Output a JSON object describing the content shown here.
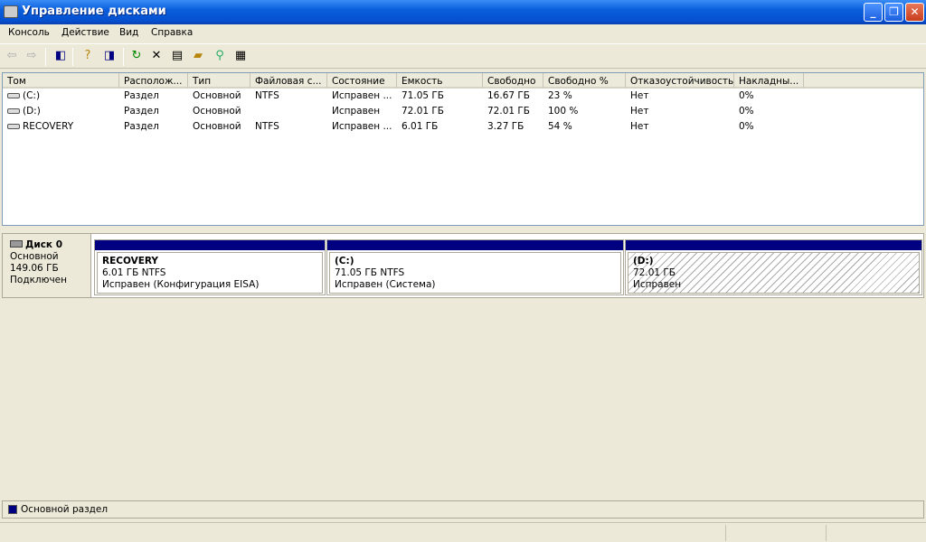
{
  "window": {
    "title": "Управление дисками",
    "minimize": "_",
    "maximize": "❐",
    "close": "✕"
  },
  "menu": [
    "Консоль",
    "Действие",
    "Вид",
    "Справка"
  ],
  "table": {
    "columns": [
      "Том",
      "Располож...",
      "Тип",
      "Файловая с...",
      "Состояние",
      "Емкость",
      "Свободно",
      "Свободно %",
      "Отказоустойчивость",
      "Накладны..."
    ],
    "rows": [
      [
        "(C:)",
        "Раздел",
        "Основной",
        "NTFS",
        "Исправен ...",
        "71.05 ГБ",
        "16.67 ГБ",
        "23 %",
        "Нет",
        "0%"
      ],
      [
        "(D:)",
        "Раздел",
        "Основной",
        "",
        "Исправен",
        "72.01 ГБ",
        "72.01 ГБ",
        "100 %",
        "Нет",
        "0%"
      ],
      [
        "RECOVERY",
        "Раздел",
        "Основной",
        "NTFS",
        "Исправен ...",
        "6.01 ГБ",
        "3.27 ГБ",
        "54 %",
        "Нет",
        "0%"
      ]
    ]
  },
  "disk": {
    "name": "Диск 0",
    "type": "Основной",
    "size": "149.06 ГБ",
    "status": "Подключен",
    "partitions": [
      {
        "name": "RECOVERY",
        "size": "6.01 ГБ NTFS",
        "status": "Исправен (Конфигурация EISA)"
      },
      {
        "name": "(C:)",
        "size": "71.05 ГБ NTFS",
        "status": "Исправен (Система)"
      },
      {
        "name": "(D:)",
        "size": "72.01 ГБ",
        "status": "Исправен"
      }
    ]
  },
  "legend": {
    "label": "Основной раздел",
    "color": "#000080"
  }
}
